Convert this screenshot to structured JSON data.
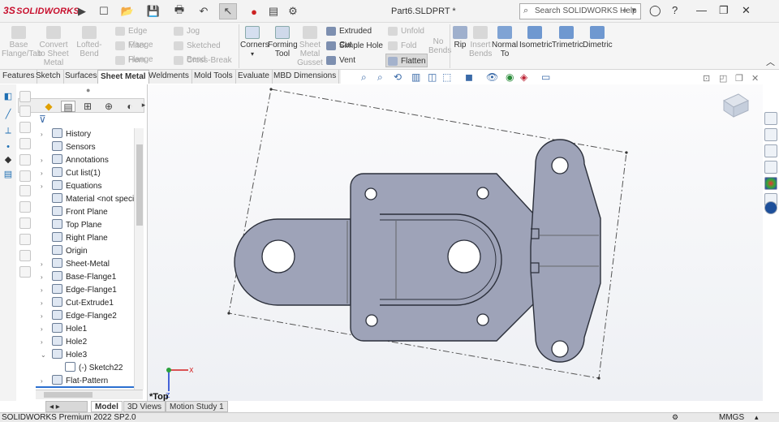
{
  "app": {
    "brand_prefix": "3S",
    "brand": "SOLIDWORKS",
    "doc_title": "Part6.SLDPRT *"
  },
  "search": {
    "placeholder": "Search SOLIDWORKS Help"
  },
  "quick_access": [
    "play-icon",
    "new-doc-icon",
    "open-icon",
    "save-icon",
    "print-icon",
    "undo-icon",
    "select-icon",
    "traffic-light-icon",
    "file-props-icon",
    "options-icon"
  ],
  "ribbon": {
    "buttons": [
      {
        "label": "Base Flange/Tab",
        "disabled": true
      },
      {
        "label": "Convert to Sheet Metal",
        "disabled": true
      },
      {
        "label": "Lofted-Bend",
        "disabled": true
      },
      {
        "label": "Corners",
        "disabled": false
      },
      {
        "label": "Forming Tool",
        "disabled": false
      },
      {
        "label": "Sheet Metal Gusset",
        "disabled": true
      },
      {
        "label": "Rip",
        "disabled": false
      },
      {
        "label": "Insert Bends",
        "disabled": true
      },
      {
        "label": "Normal To",
        "disabled": false
      },
      {
        "label": "Isometric",
        "disabled": false
      },
      {
        "label": "Trimetric",
        "disabled": false
      },
      {
        "label": "Dimetric",
        "disabled": false
      }
    ],
    "small_buttons": [
      {
        "label": "Edge Flange",
        "disabled": true
      },
      {
        "label": "Miter Flange",
        "disabled": true
      },
      {
        "label": "Hem",
        "disabled": true
      },
      {
        "label": "Jog",
        "disabled": true
      },
      {
        "label": "Sketched Bend",
        "disabled": true
      },
      {
        "label": "Cross-Break",
        "disabled": true
      },
      {
        "label": "Extruded Cut",
        "disabled": false
      },
      {
        "label": "Simple Hole",
        "disabled": false
      },
      {
        "label": "Vent",
        "disabled": false
      },
      {
        "label": "Unfold",
        "disabled": true
      },
      {
        "label": "Fold",
        "disabled": true
      },
      {
        "label": "No Bends",
        "disabled": true
      },
      {
        "label": "Flatten",
        "disabled": false,
        "active": true
      }
    ]
  },
  "tabs": [
    "Features",
    "Sketch",
    "Surfaces",
    "Sheet Metal",
    "Weldments",
    "Mold Tools",
    "Evaluate",
    "MBD Dimensions"
  ],
  "active_tab": "Sheet Metal",
  "tree": [
    {
      "label": "History",
      "expand": true
    },
    {
      "label": "Sensors",
      "expand": false
    },
    {
      "label": "Annotations",
      "expand": true
    },
    {
      "label": "Cut list(1)",
      "expand": true
    },
    {
      "label": "Equations",
      "expand": true
    },
    {
      "label": "Material <not specifie",
      "expand": false
    },
    {
      "label": "Front Plane",
      "expand": false
    },
    {
      "label": "Top Plane",
      "expand": false
    },
    {
      "label": "Right Plane",
      "expand": false
    },
    {
      "label": "Origin",
      "expand": false
    },
    {
      "label": "Sheet-Metal",
      "expand": true
    },
    {
      "label": "Base-Flange1",
      "expand": true
    },
    {
      "label": "Edge-Flange1",
      "expand": true
    },
    {
      "label": "Cut-Extrude1",
      "expand": true
    },
    {
      "label": "Edge-Flange2",
      "expand": true
    },
    {
      "label": "Hole1",
      "expand": true
    },
    {
      "label": "Hole2",
      "expand": true
    },
    {
      "label": "Hole3",
      "expand": "open"
    },
    {
      "label": "(-) Sketch22",
      "expand": false,
      "indent": true
    },
    {
      "label": "Flat-Pattern",
      "expand": true
    }
  ],
  "bottom_tabs": [
    "Model",
    "3D Views",
    "Motion Study 1"
  ],
  "active_bottom_tab": "Model",
  "view_label": "*Top",
  "triad": {
    "x": "X",
    "y": "Y",
    "z": "Z"
  },
  "status": {
    "left": "SOLIDWORKS Premium 2022 SP2.0",
    "units": "MMGS"
  },
  "colors": {
    "part_fill": "#9ea3b8",
    "part_stroke": "#2b2f3a",
    "brand_red": "#c8102e",
    "sheet_line": "#555"
  }
}
